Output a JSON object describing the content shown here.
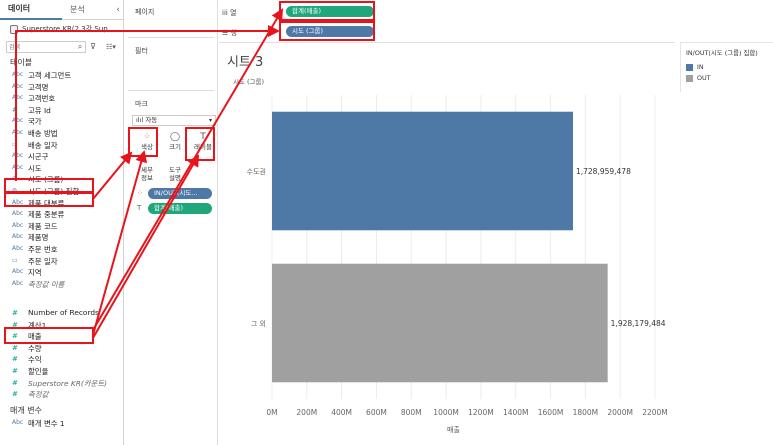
{
  "data_pane": {
    "tabs": [
      "데이터",
      "분석"
    ],
    "collapse": "‹",
    "datasource": "Superstore KR(2.3강 Sup...",
    "search_placeholder": "검색",
    "tables_title": "테이블",
    "fields": [
      {
        "type": "Abc",
        "name": "고객 세그먼트",
        "italic": false
      },
      {
        "type": "Abc",
        "name": "고객명",
        "italic": false
      },
      {
        "type": "Abc",
        "name": "고객번호",
        "italic": false
      },
      {
        "type": "#",
        "name": "고유 Id",
        "italic": false
      },
      {
        "type": "Abc",
        "name": "국가",
        "italic": false
      },
      {
        "type": "Abc",
        "name": "배송 방법",
        "italic": false
      },
      {
        "type": "▭",
        "name": "배송 일자",
        "italic": false
      },
      {
        "type": "Abc",
        "name": "시군구",
        "italic": false
      },
      {
        "type": "Abc",
        "name": "시도",
        "italic": false
      },
      {
        "type": "⊘",
        "name": "시도 (그룹)",
        "italic": false
      },
      {
        "type": "⊚",
        "name": "시도 (그룹) 집합",
        "italic": false
      },
      {
        "type": "Abc",
        "name": "제품 대분류",
        "italic": false
      },
      {
        "type": "Abc",
        "name": "제품 중분류",
        "italic": false
      },
      {
        "type": "Abc",
        "name": "제품 코드",
        "italic": false
      },
      {
        "type": "Abc",
        "name": "제품명",
        "italic": false
      },
      {
        "type": "Abc",
        "name": "주문 번호",
        "italic": false
      },
      {
        "type": "▭",
        "name": "주문 일자",
        "italic": false
      },
      {
        "type": "Abc",
        "name": "지역",
        "italic": false
      },
      {
        "type": "Abc",
        "name": "측정값 이름",
        "italic": true
      },
      {
        "type": "#",
        "name": "Number of Records",
        "italic": false
      },
      {
        "type": "#",
        "name": "계산1",
        "italic": false
      },
      {
        "type": "#",
        "name": "매출",
        "italic": false
      },
      {
        "type": "#",
        "name": "수량",
        "italic": false
      },
      {
        "type": "#",
        "name": "수익",
        "italic": false
      },
      {
        "type": "#",
        "name": "할인율",
        "italic": false
      },
      {
        "type": "#",
        "name": "Superstore KR(카운트)",
        "italic": true
      },
      {
        "type": "#",
        "name": "측정값",
        "italic": true
      }
    ],
    "params_title": "매개 변수",
    "params": [
      {
        "type": "Abc",
        "name": "매개 변수 1",
        "italic": false
      }
    ]
  },
  "shelves": {
    "pages_title": "페이지",
    "filters_title": "필터",
    "marks_title": "마크",
    "marks_type": "자동",
    "marks_type_icon": "ılıl",
    "mark_buttons": [
      {
        "icon": "⁘",
        "label": "색상"
      },
      {
        "icon": "◯",
        "label": "크기"
      },
      {
        "icon": "T",
        "label": "레이블"
      },
      {
        "icon": "",
        "label": "세부\n정보"
      },
      {
        "icon": "",
        "label": "도구\n설명"
      }
    ],
    "marks_pills": [
      "IN/OUT(시도...",
      "합계(매출)"
    ],
    "columns_label": "iii 열",
    "rows_label": "☰ 행",
    "columns_pill": "합계(매출)",
    "rows_pill": "시도 (그룹)"
  },
  "sheet": {
    "title": "시트 3",
    "row_header": "시도 (그룹)"
  },
  "legend": {
    "title": "IN/OUT(시도 (그룹) 집합)",
    "items": [
      {
        "label": "IN",
        "color": "#4e79a7"
      },
      {
        "label": "OUT",
        "color": "#a0a0a0"
      }
    ]
  },
  "chart_data": {
    "type": "bar",
    "orientation": "horizontal",
    "categories": [
      "수도권",
      "그 외"
    ],
    "values": [
      1728959478,
      1928179484
    ],
    "value_labels": [
      "1,728,959,478",
      "1,928,179,484"
    ],
    "colors": [
      "#4e79a7",
      "#a0a0a0"
    ],
    "xlabel": "매출",
    "x_ticks": [
      "0M",
      "200M",
      "400M",
      "600M",
      "800M",
      "1000M",
      "1200M",
      "1400M",
      "1600M",
      "1800M",
      "2000M",
      "2200M"
    ],
    "xlim": [
      0,
      2200000000
    ],
    "grid": true
  }
}
